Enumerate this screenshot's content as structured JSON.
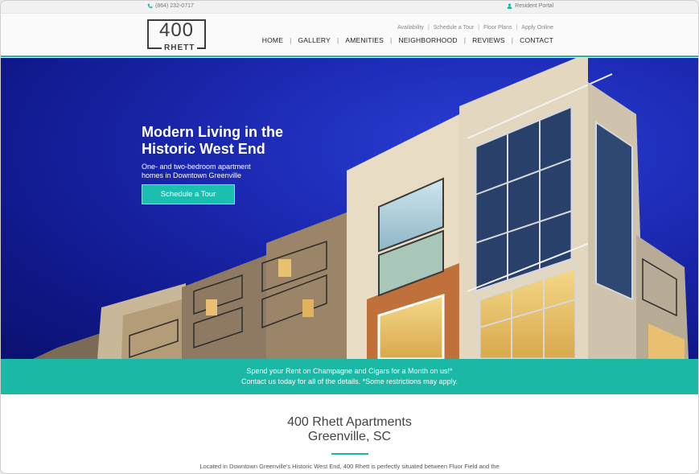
{
  "topbar": {
    "phone": "(864) 232-0717",
    "resident_portal": "Resident Portal"
  },
  "logo": {
    "number": "400",
    "word": "RHETT"
  },
  "subnav": [
    "Availability",
    "Schedule a Tour",
    "Floor Plans",
    "Apply Online"
  ],
  "mainnav": [
    "HOME",
    "GALLERY",
    "AMENITIES",
    "NEIGHBORHOOD",
    "REVIEWS",
    "CONTACT"
  ],
  "hero": {
    "title_line1": "Modern Living in the",
    "title_line2": "Historic West End",
    "subtitle": "One- and two-bedroom apartment homes in Downtown Greenville",
    "button": "Schedule a Tour"
  },
  "promo": {
    "line1": "Spend your Rent on Champagne and Cigars for a Month on us!*",
    "line2": "Contact us today for all of the details. *Some restrictions may apply."
  },
  "intro": {
    "title_line1": "400 Rhett Apartments",
    "title_line2": "Greenville, SC",
    "text": "Located in Downtown Greenville's Historic West End, 400 Rhett is perfectly situated between Fluor Field and the"
  },
  "colors": {
    "accent": "#1bb8a5",
    "hero_sky": "#1b28b0",
    "text_dark": "#333333"
  },
  "icons": {
    "phone": "phone-icon",
    "portal": "user-icon"
  }
}
